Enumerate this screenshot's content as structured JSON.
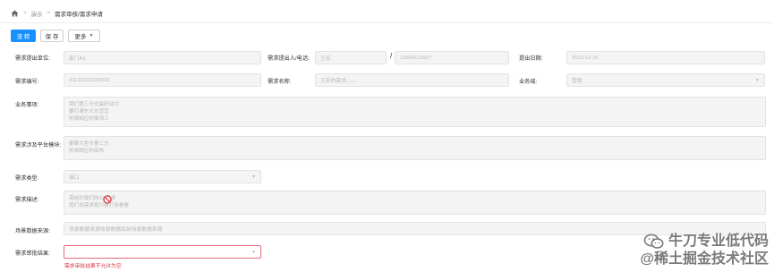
{
  "breadcrumb": {
    "items": [
      "演示",
      "需求审核/需求申请"
    ]
  },
  "toolbar": {
    "submit_label": "流 转",
    "save_label": "保 存",
    "more_label": "更多"
  },
  "form": {
    "dept": {
      "label": "需求提出单位:",
      "value": "部门A1"
    },
    "proposer": {
      "label": "需求提出人/电话:",
      "name": "王宏",
      "separator": "/",
      "phone": "13699119927"
    },
    "date": {
      "label": "提出日期:",
      "value": "2012-12-15"
    },
    "code": {
      "label": "需求编号:",
      "value": "XQ-20221106010"
    },
    "name": {
      "label": "需求名称:",
      "value": "王宏的需求。。。。"
    },
    "domain": {
      "label": "业务域:",
      "value": "营销"
    },
    "business": {
      "label": "业务事项:",
      "lines": [
        "我们第三分支最好动力",
        "要打通东天东营营",
        "则相相应的事项三"
      ]
    },
    "platform": {
      "label": "需求涉及平台模块:",
      "lines": [
        "都要大型东第三方",
        "则相相应的审核"
      ]
    },
    "type": {
      "label": "需求类型:",
      "value": "接口"
    },
    "desc": {
      "label": "需求描述:",
      "lines": [
        "需结抄我们的XX需求",
        "我们说需求我只要打测看看"
      ]
    },
    "source": {
      "label": "场景数据来源:",
      "value": "场景数据来源场景数据库前场景数据来源"
    },
    "result": {
      "label": "需求审批结果:",
      "value": "",
      "error": "需求审批结果不允许为空"
    }
  },
  "watermark": {
    "line1": "牛刀专业低代码",
    "line2": "@稀土掘金技术社区"
  },
  "colors": {
    "primary": "#1890ff",
    "error_border": "#e26a76",
    "error_text": "#d9363e",
    "disabled_bg": "#f4f4f4"
  },
  "icons": [
    "home-icon",
    "chevron-down-icon",
    "not-allowed-icon",
    "wechat-icon"
  ]
}
